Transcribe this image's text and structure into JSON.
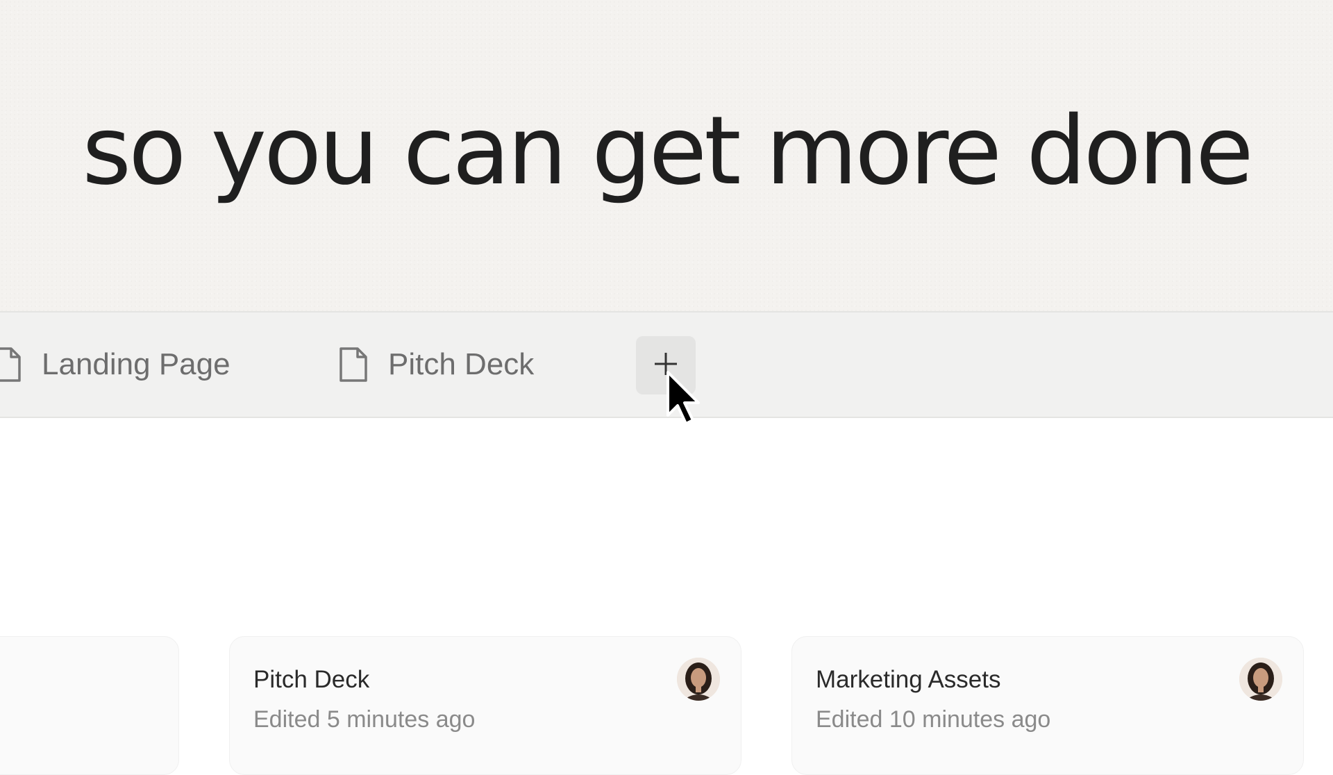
{
  "hero": {
    "headline": "so you can get more done"
  },
  "tabs": [
    {
      "label": "Landing Page",
      "icon": "document-icon"
    },
    {
      "label": "Pitch Deck",
      "icon": "document-icon"
    }
  ],
  "add_tab": {
    "icon": "plus-icon"
  },
  "cards": [
    {
      "title": "Pitch Deck",
      "subtitle": "Edited 5 minutes ago",
      "avatar": "user-avatar"
    },
    {
      "title": "Marketing Assets",
      "subtitle": "Edited 10 minutes ago",
      "avatar": "user-avatar"
    }
  ],
  "colors": {
    "hero_bg": "#f4f2ef",
    "tabbar_bg": "#f1f1f0",
    "text_dark": "#1f1f1f",
    "text_muted": "#8a8a8a"
  }
}
